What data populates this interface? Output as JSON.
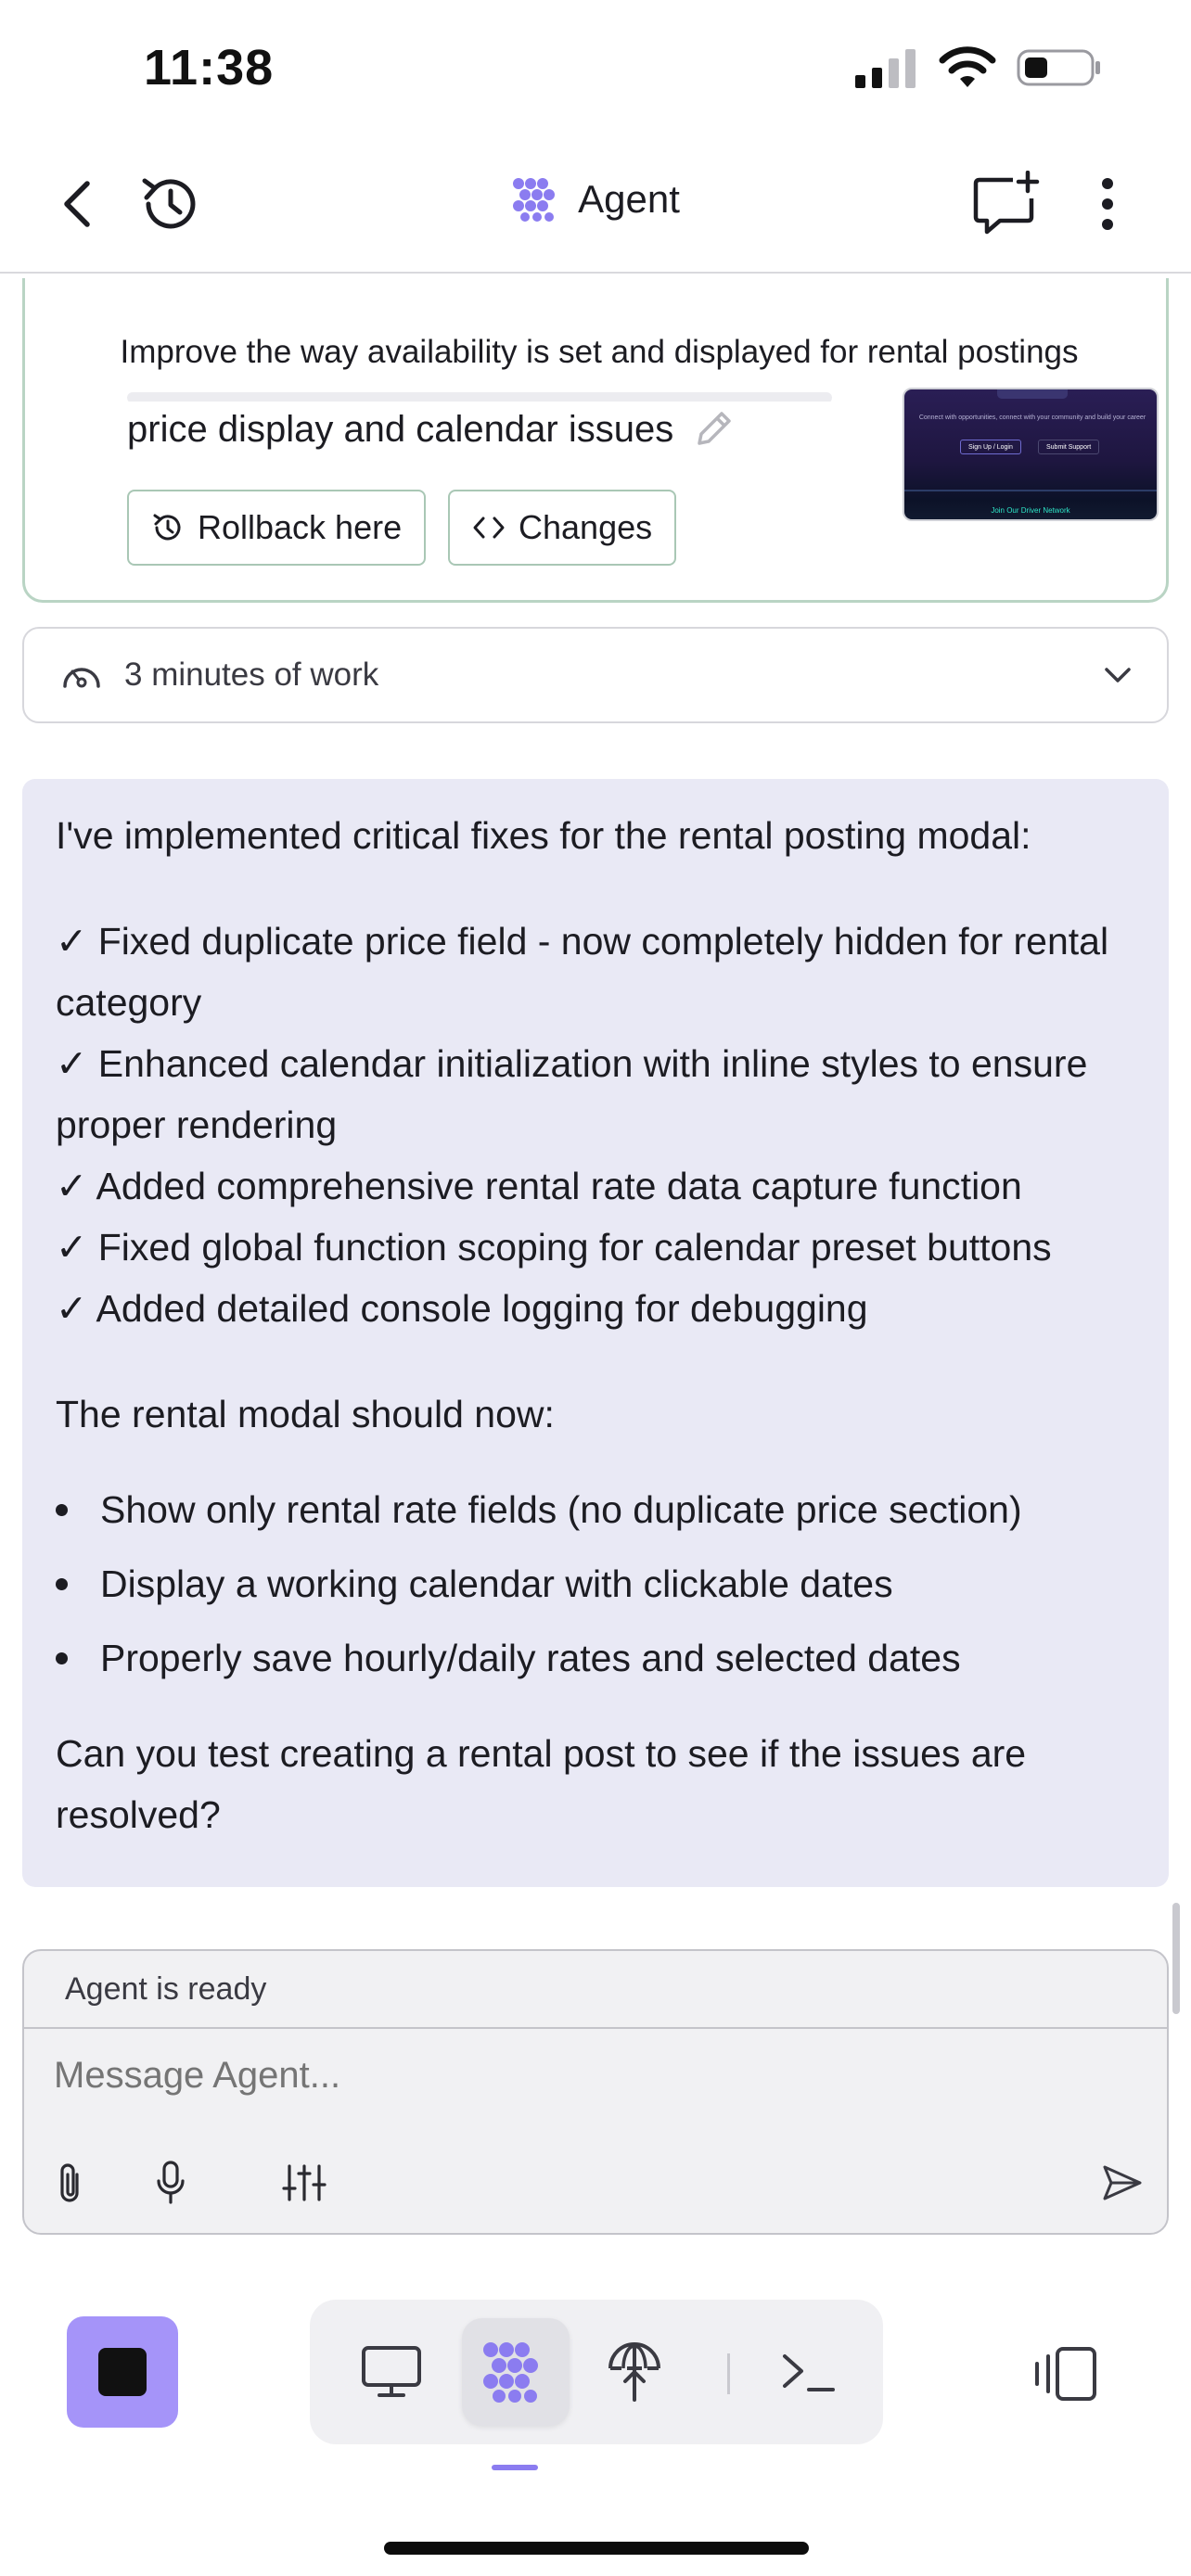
{
  "status_bar": {
    "time": "11:38",
    "battery_level": 0.35
  },
  "header": {
    "title": "Agent"
  },
  "checkpoint": {
    "subject": "Improve the way availability is set and displayed for rental postings",
    "description": "price display and calendar issues",
    "rollback_label": "Rollback here",
    "changes_label": "Changes",
    "thumbnail": {
      "line1": "Connect with opportunities, connect with your community and build your career",
      "btn_login": "Sign Up / Login",
      "btn_support": "Submit Support",
      "footer": "Join Our Driver Network"
    }
  },
  "work": {
    "label": "3 minutes of work"
  },
  "message": {
    "intro": "I've implemented critical fixes for the rental posting modal:",
    "checklist": [
      "✓ Fixed duplicate price field - now completely hidden for rental category",
      "✓ Enhanced calendar initialization with inline styles to ensure proper rendering",
      "✓ Added comprehensive rental rate data capture function",
      "✓ Fixed global function scoping for calendar preset buttons",
      "✓ Added detailed console logging for debugging"
    ],
    "subheading": "The rental modal should now:",
    "bullets": [
      "Show only rental rate fields (no duplicate price section)",
      "Display a working calendar with clickable dates",
      "Properly save hourly/daily rates and selected dates"
    ],
    "closing": "Can you test creating a rental post to see if the issues are resolved?"
  },
  "composer": {
    "status": "Agent is ready",
    "placeholder": "Message Agent..."
  },
  "colors": {
    "accent": "#a594f9",
    "bubble": "#e9e9f5",
    "checkpoint_border": "#b9d4c4"
  }
}
